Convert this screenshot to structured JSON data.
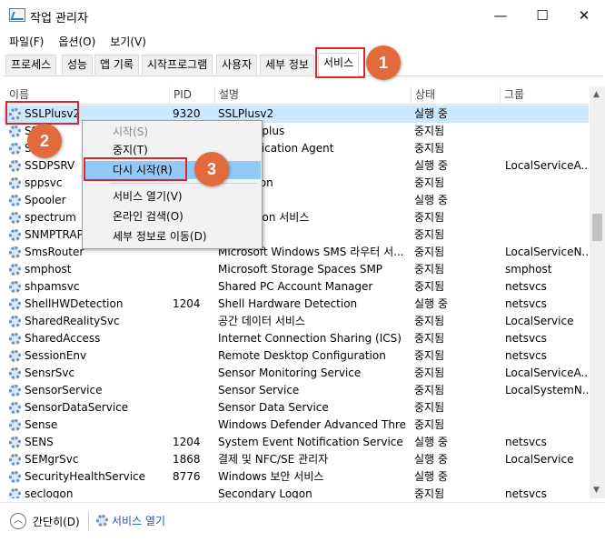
{
  "window": {
    "title": "작업 관리자",
    "minimize_glyph": "—",
    "maximize_glyph": "☐",
    "close_glyph": "✕"
  },
  "menu": [
    "파일(F)",
    "옵션(O)",
    "보기(V)"
  ],
  "tabs": [
    "프로세스",
    "성능",
    "앱 기록",
    "시작프로그램",
    "사용자",
    "세부 정보",
    "서비스"
  ],
  "active_tab": "서비스",
  "columns": {
    "name": "이름",
    "pid": "PID",
    "desc": "설명",
    "status": "상태",
    "group": "그룹"
  },
  "rows": [
    {
      "name": "SSLPlusv2",
      "pid": "9320",
      "desc": "SSLPlusv2",
      "status": "실행 중",
      "group": ""
    },
    {
      "name": "SS",
      "pid": "",
      "desc": "ia™ SSLplus",
      "status": "중지됨",
      "group": ""
    },
    {
      "name": "SS",
      "pid": "",
      "desc": "Authentication Agent",
      "status": "중지됨",
      "group": ""
    },
    {
      "name": "SSDPSRV",
      "pid": "",
      "desc": "scovery",
      "status": "실행 중",
      "group": "LocalServiceA..."
    },
    {
      "name": "sppsvc",
      "pid": "",
      "desc": "Protection",
      "status": "중지됨",
      "group": ""
    },
    {
      "name": "Spooler",
      "pid": "",
      "desc": "ooler",
      "status": "실행 중",
      "group": ""
    },
    {
      "name": "spectrum",
      "pid": "",
      "desc": "Perception 서비스",
      "status": "중지됨",
      "group": ""
    },
    {
      "name": "SNMPTRAP",
      "pid": "",
      "desc": "랩",
      "status": "중지됨",
      "group": ""
    },
    {
      "name": "SmsRouter",
      "pid": "",
      "desc": "Microsoft Windows SMS 라우터 서...",
      "status": "중지됨",
      "group": "LocalServiceN..."
    },
    {
      "name": "smphost",
      "pid": "",
      "desc": "Microsoft Storage Spaces SMP",
      "status": "중지됨",
      "group": "smphost"
    },
    {
      "name": "shpamsvc",
      "pid": "",
      "desc": "Shared PC Account Manager",
      "status": "중지됨",
      "group": "netsvcs"
    },
    {
      "name": "ShellHWDetection",
      "pid": "1204",
      "desc": "Shell Hardware Detection",
      "status": "실행 중",
      "group": "netsvcs"
    },
    {
      "name": "SharedRealitySvc",
      "pid": "",
      "desc": "공간 데이터 서비스",
      "status": "중지됨",
      "group": "LocalService"
    },
    {
      "name": "SharedAccess",
      "pid": "",
      "desc": "Internet Connection Sharing (ICS)",
      "status": "중지됨",
      "group": "netsvcs"
    },
    {
      "name": "SessionEnv",
      "pid": "",
      "desc": "Remote Desktop Configuration",
      "status": "중지됨",
      "group": "netsvcs"
    },
    {
      "name": "SensrSvc",
      "pid": "",
      "desc": "Sensor Monitoring Service",
      "status": "중지됨",
      "group": "LocalServiceA..."
    },
    {
      "name": "SensorService",
      "pid": "",
      "desc": "Sensor Service",
      "status": "중지됨",
      "group": "LocalSystemN..."
    },
    {
      "name": "SensorDataService",
      "pid": "",
      "desc": "Sensor Data Service",
      "status": "중지됨",
      "group": ""
    },
    {
      "name": "Sense",
      "pid": "",
      "desc": "Windows Defender Advanced Threa...",
      "status": "중지됨",
      "group": ""
    },
    {
      "name": "SENS",
      "pid": "1204",
      "desc": "System Event Notification Service",
      "status": "실행 중",
      "group": "netsvcs"
    },
    {
      "name": "SEMgrSvc",
      "pid": "1868",
      "desc": "결제 및 NFC/SE 관리자",
      "status": "실행 중",
      "group": "LocalService"
    },
    {
      "name": "SecurityHealthService",
      "pid": "8776",
      "desc": "Windows 보안 서비스",
      "status": "실행 중",
      "group": ""
    },
    {
      "name": "seclogon",
      "pid": "",
      "desc": "Secondary Logon",
      "status": "중지됨",
      "group": "netsvcs"
    }
  ],
  "context_menu": {
    "start": "시작(S)",
    "stop": "중지(T)",
    "restart": "다시 시작(R)",
    "open_services": "서비스 열기(V)",
    "search_online": "온라인 검색(O)",
    "go_to_details": "세부 정보로 이동(D)"
  },
  "bottom": {
    "collapse_label": "간단히(D)",
    "open_services_link": "서비스 열기"
  },
  "steps": [
    "1",
    "2",
    "3"
  ],
  "colors": {
    "highlight": "#e0242b",
    "badge": "#e26a3c",
    "selection": "#cce8ff",
    "menu_hover": "#91c9f7"
  }
}
